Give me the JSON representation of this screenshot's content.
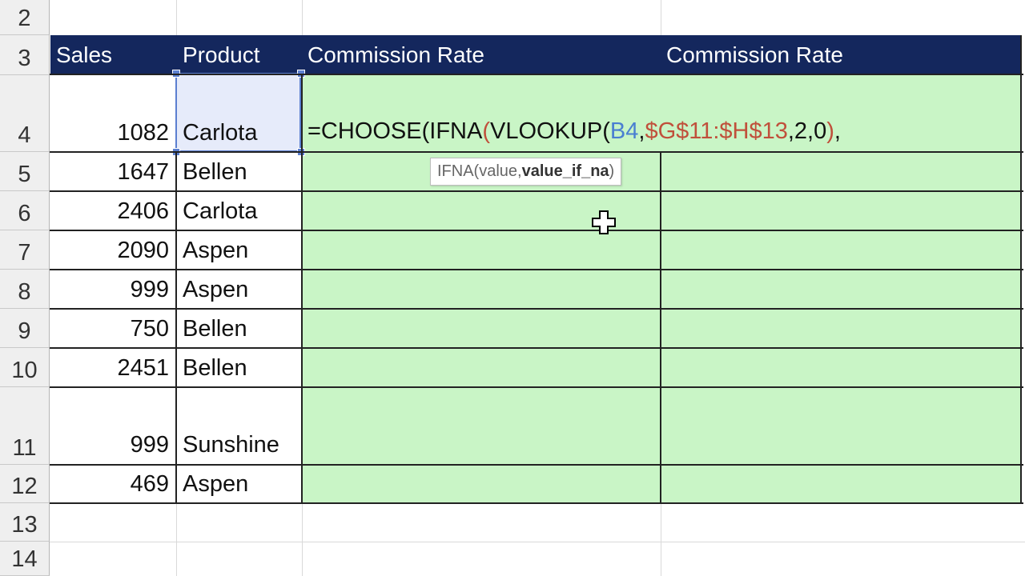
{
  "headers": {
    "sales": "Sales",
    "product": "Product",
    "commission_rate_1": "Commission Rate",
    "commission_rate_2": "Commission Rate"
  },
  "rows": [
    {
      "row": "2",
      "sales": "",
      "product": ""
    },
    {
      "row": "3",
      "sales": "",
      "product": ""
    },
    {
      "row": "4",
      "sales": "1082",
      "product": "Carlota"
    },
    {
      "row": "5",
      "sales": "1647",
      "product": "Bellen"
    },
    {
      "row": "6",
      "sales": "2406",
      "product": "Carlota"
    },
    {
      "row": "7",
      "sales": "2090",
      "product": "Aspen"
    },
    {
      "row": "8",
      "sales": "999",
      "product": "Aspen"
    },
    {
      "row": "9",
      "sales": "750",
      "product": "Bellen"
    },
    {
      "row": "10",
      "sales": "2451",
      "product": "Bellen"
    },
    {
      "row": "11",
      "sales": "999",
      "product": "Sunshine"
    },
    {
      "row": "12",
      "sales": "469",
      "product": "Aspen"
    },
    {
      "row": "13",
      "sales": "",
      "product": ""
    },
    {
      "row": "14",
      "sales": "",
      "product": ""
    }
  ],
  "formula": {
    "part1": "=CHOOSE(IFNA",
    "part2": "(",
    "part3": "VLOOKUP(",
    "part4": "B4",
    "part5": ",",
    "part6": "$G$11:$H$13",
    "part7": ",2,0",
    "part8": ")",
    "part9": ","
  },
  "tooltip": {
    "func": "IFNA(value, ",
    "active_arg": "value_if_na",
    "close": ")"
  },
  "colors": {
    "header_bg": "#14275d",
    "fill_green": "#c9f5c6",
    "selection": "#5b7fd0"
  }
}
